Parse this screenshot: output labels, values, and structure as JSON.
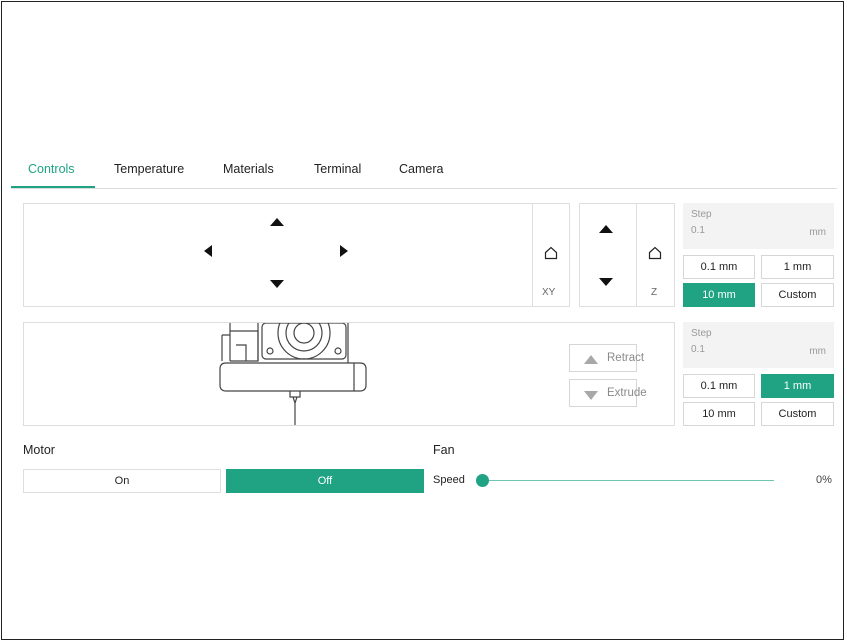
{
  "tabs": [
    {
      "label": "Controls",
      "active": true
    },
    {
      "label": "Temperature",
      "active": false
    },
    {
      "label": "Materials",
      "active": false
    },
    {
      "label": "Terminal",
      "active": false
    },
    {
      "label": "Camera",
      "active": false
    }
  ],
  "jog": {
    "xy_label": "XY",
    "z_label": "Z"
  },
  "move_step": {
    "title": "Step",
    "value": "0.1",
    "unit": "mm",
    "options": [
      "0.1 mm",
      "1 mm",
      "10 mm",
      "Custom"
    ],
    "selected": "10 mm"
  },
  "extruder": {
    "retract_label": "Retract",
    "extrude_label": "Extrude"
  },
  "extrude_step": {
    "title": "Step",
    "value": "0.1",
    "unit": "mm",
    "options": [
      "0.1 mm",
      "1 mm",
      "10 mm",
      "Custom"
    ],
    "selected": "1 mm"
  },
  "motor": {
    "title": "Motor",
    "on_label": "On",
    "off_label": "Off",
    "selected": "Off"
  },
  "fan": {
    "title": "Fan",
    "speed_label": "Speed",
    "speed_value": "0%",
    "speed_fraction": 0
  },
  "colors": {
    "accent": "#1fa383",
    "border": "#dedede",
    "step_bg": "#f3f3f3"
  }
}
